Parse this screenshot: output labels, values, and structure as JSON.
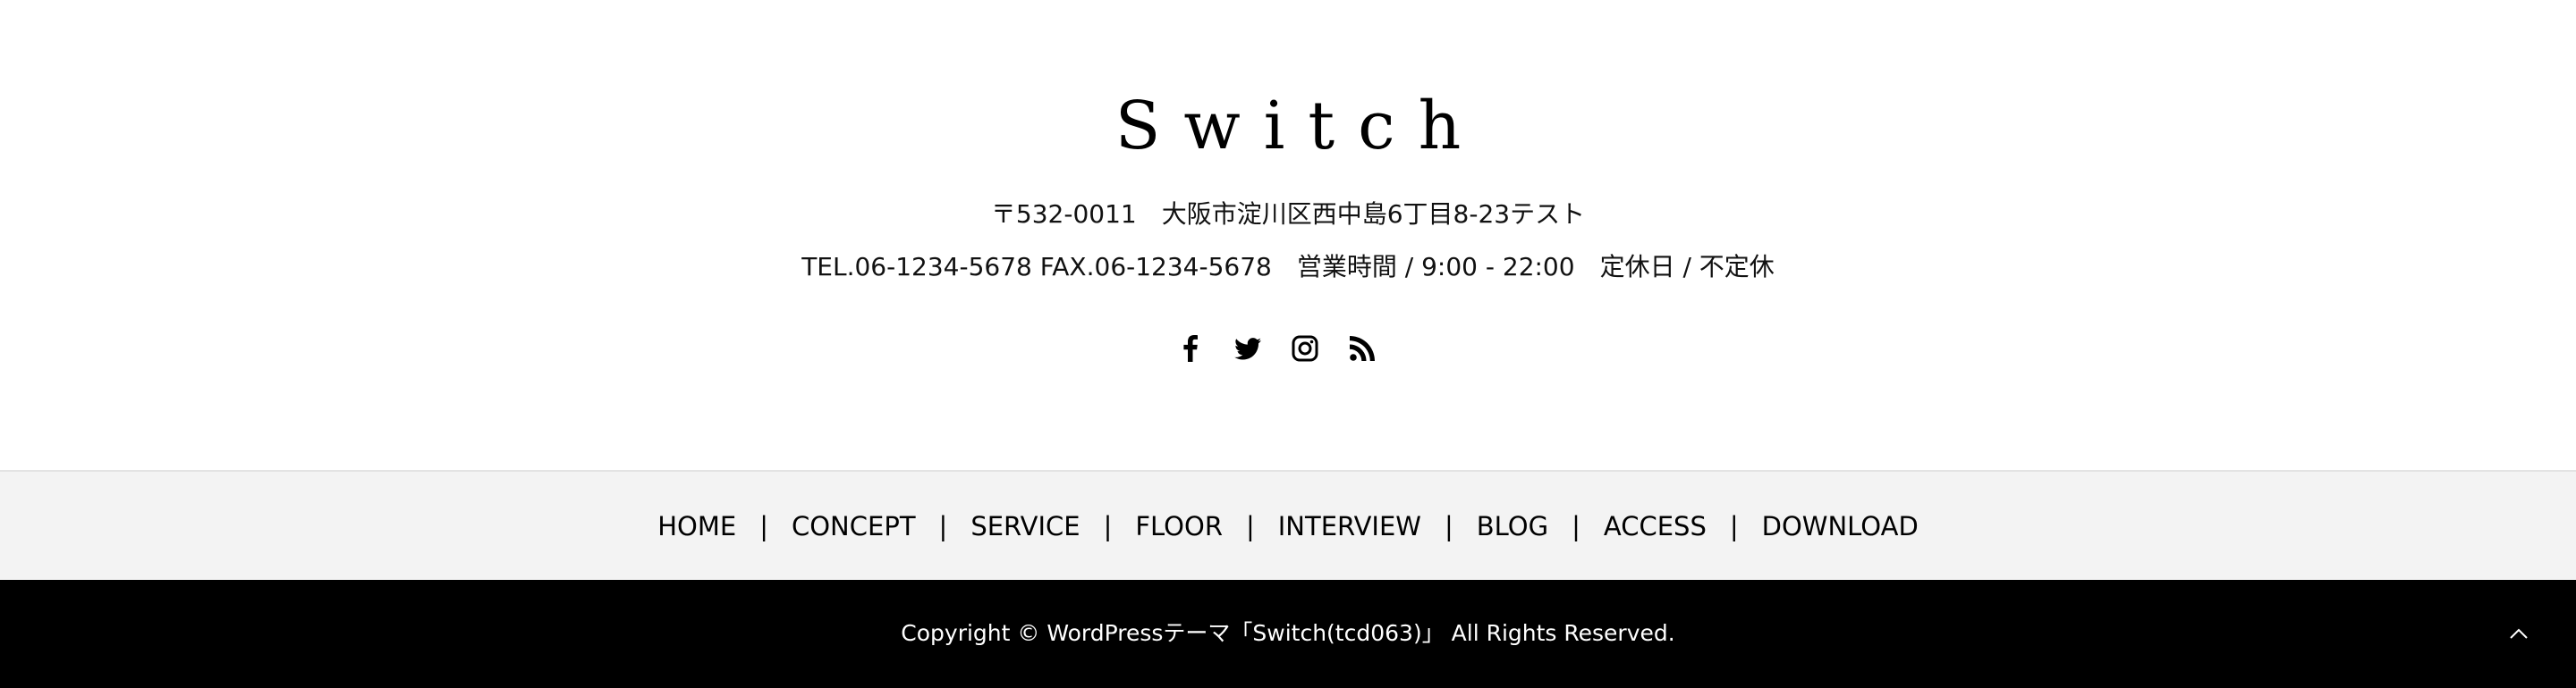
{
  "footer": {
    "logo": "Switch",
    "address": "〒532-0011　大阪市淀川区西中島6丁目8-23テスト",
    "contact": "TEL.06-1234-5678 FAX.06-1234-5678　営業時間 / 9:00 - 22:00　定休日 / 不定休",
    "social": [
      {
        "name": "facebook-icon"
      },
      {
        "name": "twitter-icon"
      },
      {
        "name": "instagram-icon"
      },
      {
        "name": "rss-icon"
      }
    ]
  },
  "nav": {
    "items": [
      {
        "label": "HOME"
      },
      {
        "label": "CONCEPT"
      },
      {
        "label": "SERVICE"
      },
      {
        "label": "FLOOR"
      },
      {
        "label": "INTERVIEW"
      },
      {
        "label": "BLOG"
      },
      {
        "label": "ACCESS"
      },
      {
        "label": "DOWNLOAD"
      }
    ],
    "separator": "|"
  },
  "copyright": {
    "text": "Copyright © WordPressテーマ「Switch(tcd063)」 All Rights Reserved.",
    "page_top_icon": "chevron-up-icon"
  },
  "colors": {
    "background": "#ffffff",
    "nav_background": "#f3f3f3",
    "copyright_background": "#000000",
    "copyright_text": "#ffffff"
  }
}
